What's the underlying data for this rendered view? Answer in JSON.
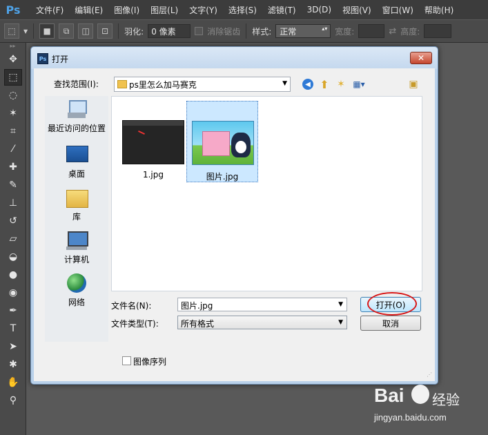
{
  "app": {
    "logo": "Ps",
    "menu": [
      "文件(F)",
      "编辑(E)",
      "图像(I)",
      "图层(L)",
      "文字(Y)",
      "选择(S)",
      "滤镜(T)",
      "3D(D)",
      "视图(V)",
      "窗口(W)",
      "帮助(H)"
    ]
  },
  "options": {
    "feather_label": "羽化:",
    "feather_value": "0 像素",
    "antialias_label": "消除锯齿",
    "style_label": "样式:",
    "style_value": "正常",
    "width_label": "宽度:",
    "height_label": "高度:"
  },
  "dialog": {
    "title": "打开",
    "close_label": "✕",
    "lookin_label": "查找范围(I):",
    "lookin_value": "ps里怎么加马赛克",
    "places": [
      {
        "label": "最近访问的位置"
      },
      {
        "label": "桌面"
      },
      {
        "label": "库"
      },
      {
        "label": "计算机"
      },
      {
        "label": "网络"
      }
    ],
    "files": [
      {
        "name": "1.jpg",
        "selected": false
      },
      {
        "name": "图片.jpg",
        "selected": true
      }
    ],
    "filename_label": "文件名(N):",
    "filename_value": "图片.jpg",
    "filetype_label": "文件类型(T):",
    "filetype_value": "所有格式",
    "open_label": "打开(O)",
    "cancel_label": "取消",
    "image_sequence_label": "图像序列"
  },
  "watermark": {
    "brand": "Bai",
    "cn": "经验",
    "url": "jingyan.baidu.com"
  },
  "colors": {
    "highlight_ring": "#d81818",
    "selection": "#cce8ff",
    "dialog_frame": "#b9d1ea"
  }
}
